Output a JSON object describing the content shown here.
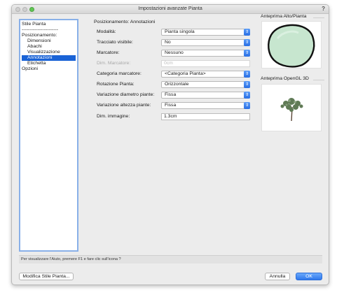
{
  "window": {
    "title": "Impostazioni avanzate Pianta",
    "help": "?"
  },
  "sidebar": {
    "items": [
      {
        "label": "Stile Pianta",
        "selected": false
      },
      {
        "label": "-----------------------",
        "selected": false
      },
      {
        "label": "Posizionamento:",
        "selected": false
      },
      {
        "label": "Dimensioni",
        "selected": false
      },
      {
        "label": "Abachi",
        "selected": false
      },
      {
        "label": "Visualizzazione",
        "selected": false
      },
      {
        "label": "Annotazioni",
        "selected": true
      },
      {
        "label": "Etichetta",
        "selected": false
      },
      {
        "label": "Opzioni",
        "selected": false
      }
    ]
  },
  "main": {
    "section_title": "Posizionamento: Annotazioni",
    "fields": [
      {
        "label": "Modalità:",
        "value": "Pianta singola"
      },
      {
        "label": "Tracciato visibile:",
        "value": "No"
      },
      {
        "label": "Marcatore:",
        "value": "Nessuno"
      },
      {
        "label": "Dim. Marcatore:",
        "value": "0cm"
      },
      {
        "label": "Categoria marcatore:",
        "value": "<Categoria Pianta>"
      },
      {
        "label": "Rotazione Pianta:",
        "value": "Orizzontale"
      },
      {
        "label": "Variazione diametro piante:",
        "value": "Fissa"
      },
      {
        "label": "Variazione altezza piante:",
        "value": "Fissa"
      },
      {
        "label": "Dim. immagine:",
        "value": "1.3cm"
      }
    ]
  },
  "previews": {
    "top_title": "Anteprima Alto/Pianta",
    "opengl_title": "Anteprima OpenGL 3D"
  },
  "help_text": "Per visualizzare l'Aiuto, premere F1 e fare clic sull'icona ?",
  "buttons": {
    "modify_style": "Modifica Stile Pianta...",
    "cancel": "Annulla",
    "ok": "OK"
  },
  "colors": {
    "accent": "#1a63d6",
    "plant_fill": "#c7e6cf",
    "sidebar_border": "#89b0e8"
  }
}
